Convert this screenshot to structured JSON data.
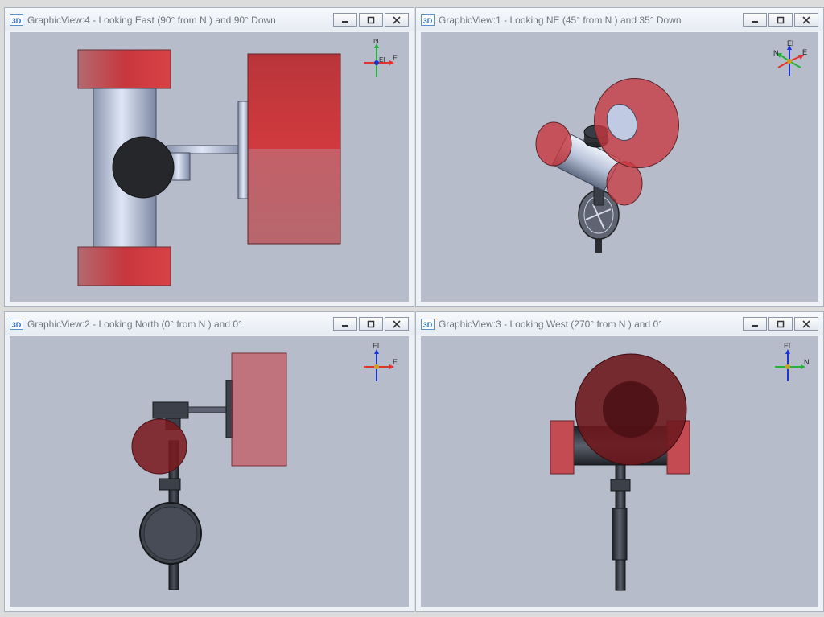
{
  "views": [
    {
      "badge": "3D",
      "title": "GraphicView:4 - Looking East (90° from N ) and 90° Down",
      "triad": {
        "label_a": "N",
        "label_b": "E",
        "label_c": "El"
      }
    },
    {
      "badge": "3D",
      "title": "GraphicView:1 - Looking NE (45° from N ) and 35° Down",
      "triad": {
        "label_a": "N",
        "label_b": "E",
        "label_c": "El"
      }
    },
    {
      "badge": "3D",
      "title": "GraphicView:2 - Looking North (0° from N ) and 0°",
      "triad": {
        "label_a": "El",
        "label_b": "E"
      }
    },
    {
      "badge": "3D",
      "title": "GraphicView:3 - Looking West (270° from N ) and 0°",
      "triad": {
        "label_a": "El",
        "label_b": "N"
      }
    }
  ],
  "colors": {
    "viewport_bg": "#b7bccb",
    "flange_red": "#c8373e",
    "pipe_blue": "#c0cae2",
    "dark_part": "#2b2d32",
    "axis_red": "#e0342e",
    "axis_green": "#23b23c",
    "axis_blue": "#1b33d6"
  }
}
